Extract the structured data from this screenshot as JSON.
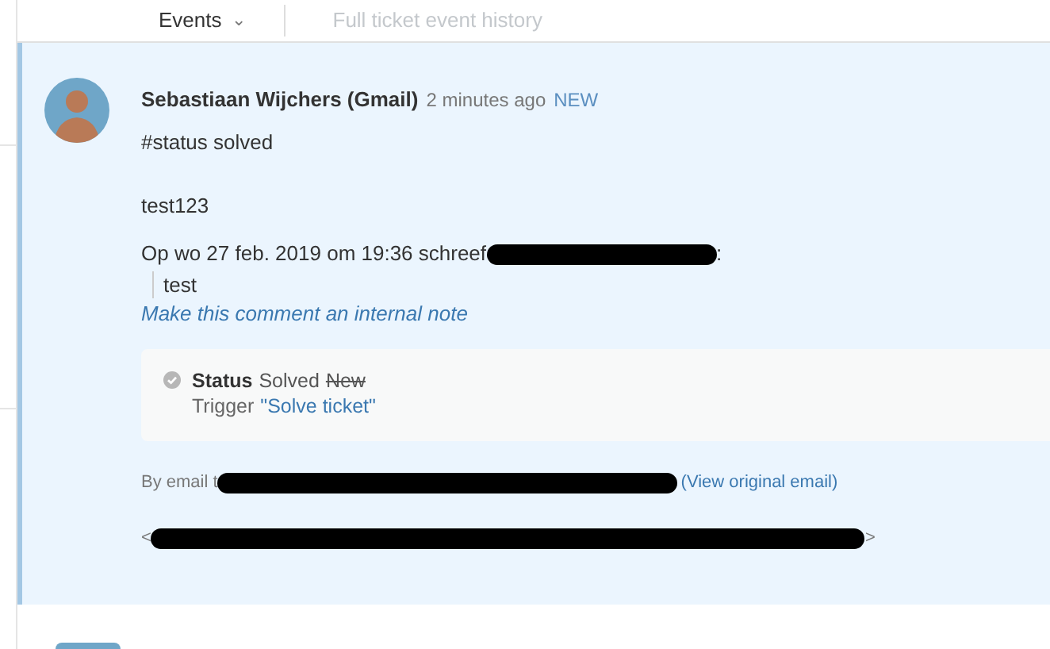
{
  "toolbar": {
    "dropdown": "Events",
    "caret": "⌄",
    "link": "Full ticket event history"
  },
  "comment": {
    "author": "Sebastiaan Wijchers (Gmail)",
    "time": "2 minutes ago",
    "badge": "NEW",
    "body": [
      "#status solved",
      "test123"
    ],
    "quote_header": [
      {
        "kind": "text",
        "text": "Op wo 27 feb. 2019 om 19:36 schreef"
      },
      {
        "kind": "redaction"
      },
      {
        "kind": "text",
        "text": ":"
      }
    ],
    "quote": "test",
    "action_link": "Make this comment an internal note",
    "event": {
      "field": "Status",
      "new_value": "Solved",
      "old_value": "New",
      "trigger_label": "Trigger",
      "trigger": "\"Solve ticket\""
    },
    "via": [
      {
        "kind": "text",
        "text": "By email t"
      },
      {
        "kind": "redaction"
      },
      {
        "kind": "link",
        "text": "(View original email)"
      }
    ],
    "recipients": [
      {
        "kind": "text",
        "text": "<"
      },
      {
        "kind": "redaction"
      },
      {
        "kind": "text",
        "text": ">"
      }
    ]
  }
}
